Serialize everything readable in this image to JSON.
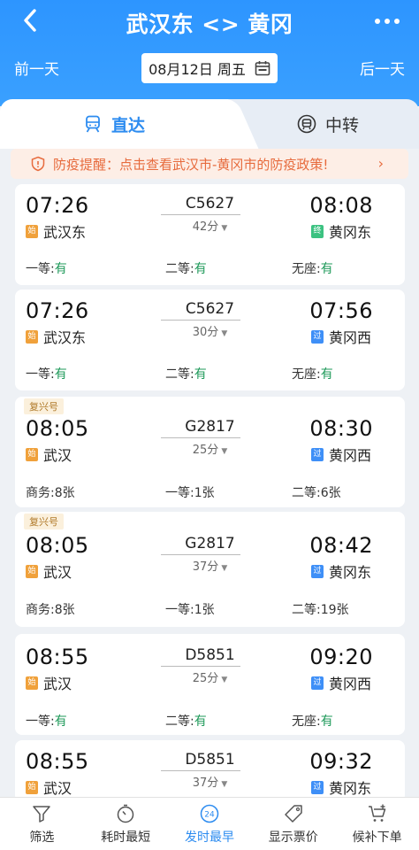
{
  "header": {
    "title": "武汉东 <> 黄冈",
    "prev_day": "前一天",
    "next_day": "后一天",
    "date": "08月12日 周五"
  },
  "tabs": {
    "direct": "直达",
    "transfer": "中转"
  },
  "notice": {
    "text": "防疫提醒：点击查看武汉市-黄冈市的防疫政策!"
  },
  "trains": [
    {
      "badge": "",
      "dep_time": "07:26",
      "train_no": "C5627",
      "duration": "42分",
      "arr_time": "08:08",
      "dep_tag": "始",
      "dep_station": "武汉东",
      "arr_tag": "终",
      "arr_station": "黄冈东",
      "seats": [
        {
          "label": "一等:",
          "value": "有"
        },
        {
          "label": "二等:",
          "value": "有"
        },
        {
          "label": "无座:",
          "value": "有"
        }
      ]
    },
    {
      "badge": "",
      "dep_time": "07:26",
      "train_no": "C5627",
      "duration": "30分",
      "arr_time": "07:56",
      "dep_tag": "始",
      "dep_station": "武汉东",
      "arr_tag": "过",
      "arr_station": "黄冈西",
      "seats": [
        {
          "label": "一等:",
          "value": "有"
        },
        {
          "label": "二等:",
          "value": "有"
        },
        {
          "label": "无座:",
          "value": "有"
        }
      ]
    },
    {
      "badge": "复兴号",
      "dep_time": "08:05",
      "train_no": "G2817",
      "duration": "25分",
      "arr_time": "08:30",
      "dep_tag": "始",
      "dep_station": "武汉",
      "arr_tag": "过",
      "arr_station": "黄冈西",
      "seats": [
        {
          "label": "商务:",
          "value": "8张"
        },
        {
          "label": "一等:",
          "value": "1张"
        },
        {
          "label": "二等:",
          "value": "6张"
        }
      ]
    },
    {
      "badge": "复兴号",
      "dep_time": "08:05",
      "train_no": "G2817",
      "duration": "37分",
      "arr_time": "08:42",
      "dep_tag": "始",
      "dep_station": "武汉",
      "arr_tag": "过",
      "arr_station": "黄冈东",
      "seats": [
        {
          "label": "商务:",
          "value": "8张"
        },
        {
          "label": "一等:",
          "value": "1张"
        },
        {
          "label": "二等:",
          "value": "19张"
        }
      ]
    },
    {
      "badge": "",
      "dep_time": "08:55",
      "train_no": "D5851",
      "duration": "25分",
      "arr_time": "09:20",
      "dep_tag": "始",
      "dep_station": "武汉",
      "arr_tag": "过",
      "arr_station": "黄冈西",
      "seats": [
        {
          "label": "一等:",
          "value": "有"
        },
        {
          "label": "二等:",
          "value": "有"
        },
        {
          "label": "无座:",
          "value": "有"
        }
      ]
    },
    {
      "badge": "",
      "dep_time": "08:55",
      "train_no": "D5851",
      "duration": "37分",
      "arr_time": "09:32",
      "dep_tag": "始",
      "dep_station": "武汉",
      "arr_tag": "过",
      "arr_station": "黄冈东",
      "seats": []
    }
  ],
  "bottom_bar": {
    "items": [
      {
        "label": "筛选",
        "icon": "filter-icon"
      },
      {
        "label": "耗时最短",
        "icon": "timer-icon"
      },
      {
        "label": "发时最早",
        "icon": "clock-24-icon"
      },
      {
        "label": "显示票价",
        "icon": "price-tag-icon"
      },
      {
        "label": "候补下单",
        "icon": "cart-icon"
      }
    ],
    "active_index": 2,
    "clock_number": "24"
  },
  "colors": {
    "header_blue": "#2d95ff",
    "accent_blue": "#2d8cf0",
    "notice_orange": "#e76b3d",
    "available_green": "#1f9a5a",
    "tag_orange": "#f0a13b",
    "tag_green": "#3cc281",
    "tag_blue": "#3e8ff7"
  }
}
